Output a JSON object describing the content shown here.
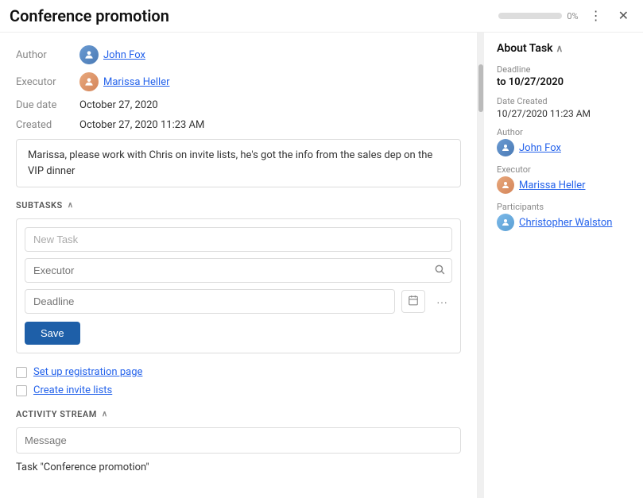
{
  "header": {
    "title": "Conference promotion",
    "progress_percent": "0%",
    "progress_value": 0,
    "menu_icon": "⋮",
    "close_icon": "✕"
  },
  "task_details": {
    "author_label": "Author",
    "author_name": "John Fox",
    "executor_label": "Executor",
    "executor_name": "Marissa Heller",
    "due_date_label": "Due date",
    "due_date_value": "October 27, 2020",
    "created_label": "Created",
    "created_value": "October 27, 2020 11:23 AM",
    "description": "Marissa, please work with Chris on invite lists, he's got the info from the sales dep on the VIP dinner"
  },
  "subtasks": {
    "section_label": "SUBTASKS",
    "new_task_placeholder": "New Task",
    "executor_placeholder": "Executor",
    "deadline_placeholder": "Deadline",
    "save_label": "Save",
    "items": [
      {
        "label": "Set up registration page",
        "checked": false
      },
      {
        "label": "Create invite lists",
        "checked": false
      }
    ]
  },
  "activity": {
    "section_label": "ACTIVITY STREAM",
    "message_placeholder": "Message",
    "task_log": "Task \"Conference promotion\""
  },
  "right_panel": {
    "title": "About Task",
    "chevron": "^",
    "deadline_label": "Deadline",
    "deadline_value": "to 10/27/2020",
    "date_created_label": "Date Created",
    "date_created_value": "10/27/2020 11:23 AM",
    "author_label": "Author",
    "author_name": "John Fox",
    "executor_label": "Executor",
    "executor_name": "Marissa Heller",
    "participants_label": "Participants",
    "participant_name": "Christopher Walston"
  }
}
